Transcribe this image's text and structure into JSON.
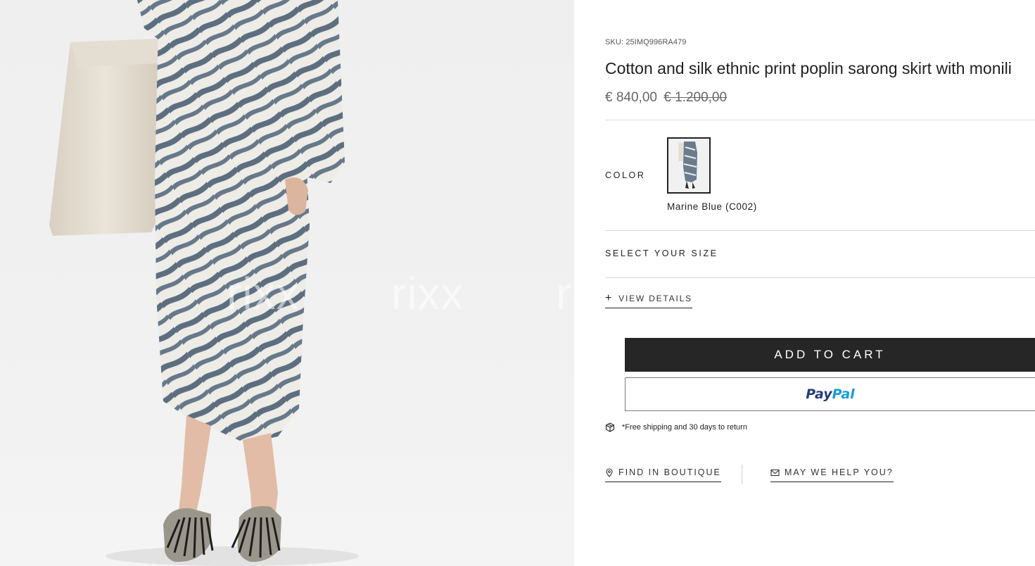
{
  "product": {
    "sku": "SKU: 25IMQ996RA479",
    "title": "Cotton and silk ethnic print poplin sarong skirt with monili",
    "price_current": "€ 840,00",
    "price_original": "€ 1.200,00"
  },
  "color": {
    "label": "COLOR",
    "selected_name": "Marine Blue (C002)"
  },
  "size": {
    "label": "SELECT YOUR SIZE"
  },
  "details": {
    "label": "VIEW DETAILS"
  },
  "actions": {
    "add_to_cart": "ADD TO CART",
    "paypal_pay": "Pay",
    "paypal_pal": "Pal"
  },
  "shipping": {
    "text": "*Free shipping and 30 days to return"
  },
  "links": {
    "find_boutique": "FIND IN BOUTIQUE",
    "help": "MAY WE HELP YOU?"
  },
  "watermark": {
    "text": "rixx"
  },
  "colors": {
    "button_dark": "#262626",
    "paypal_blue_dark": "#253b80",
    "paypal_blue_light": "#179bd7",
    "print_stripe": "#5c6e80"
  },
  "icons": [
    "plus-icon",
    "package-icon",
    "location-pin-icon",
    "mail-icon"
  ]
}
